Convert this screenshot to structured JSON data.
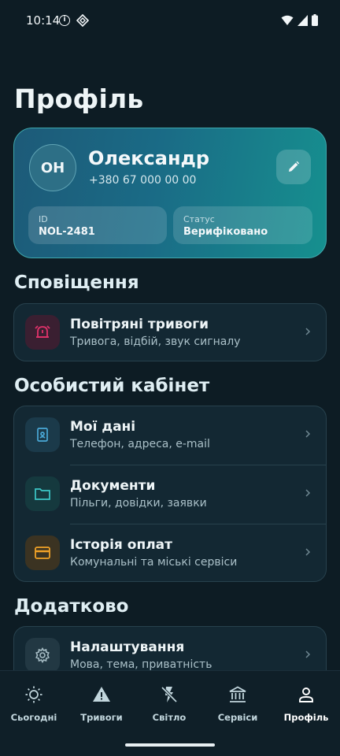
{
  "status_bar": {
    "time": "10:14",
    "info_icon": "i"
  },
  "page": {
    "title": "Профіль"
  },
  "profile": {
    "initials": "ОН",
    "name": "Олександр",
    "phone": "+380 67 000 00 00",
    "id_label": "ID",
    "id_value": "NOL-2481",
    "status_label": "Статус",
    "status_value": "Верифіковано",
    "edit_icon": "pencil-icon"
  },
  "sections": {
    "notifications": {
      "title": "Сповіщення",
      "items": [
        {
          "title": "Повітряні тривоги",
          "subtitle": "Тривога, відбій, звук сигналу",
          "icon": "alarm-icon",
          "icon_color": "#e0326a"
        }
      ]
    },
    "cabinet": {
      "title": "Особистий кабінет",
      "items": [
        {
          "title": "Мої дані",
          "subtitle": "Телефон, адреса, e-mail",
          "icon": "id-card-icon",
          "icon_color": "#4aa9d8"
        },
        {
          "title": "Документи",
          "subtitle": "Пільги, довідки, заявки",
          "icon": "folder-icon",
          "icon_color": "#3cc8c8"
        },
        {
          "title": "Історія оплат",
          "subtitle": "Комунальні та міські сервіси",
          "icon": "credit-card-icon",
          "icon_color": "#f1a227"
        }
      ]
    },
    "extra": {
      "title": "Додатково",
      "items": [
        {
          "title": "Налаштування",
          "subtitle": "Мова, тема, приватність",
          "icon": "gear-icon",
          "icon_color": "#a6bcc4"
        }
      ]
    }
  },
  "nav": {
    "items": [
      {
        "label": "Сьогодні",
        "icon": "sun-icon"
      },
      {
        "label": "Тривоги",
        "icon": "warning-icon"
      },
      {
        "label": "Світло",
        "icon": "power-off-icon"
      },
      {
        "label": "Сервіси",
        "icon": "institution-icon"
      },
      {
        "label": "Профіль",
        "icon": "person-icon",
        "active": true
      }
    ]
  },
  "colors": {
    "background": "#0d1c24",
    "card": "#132833",
    "accent_gradient_start": "#1d5a78",
    "accent_gradient_end": "#16908f"
  }
}
